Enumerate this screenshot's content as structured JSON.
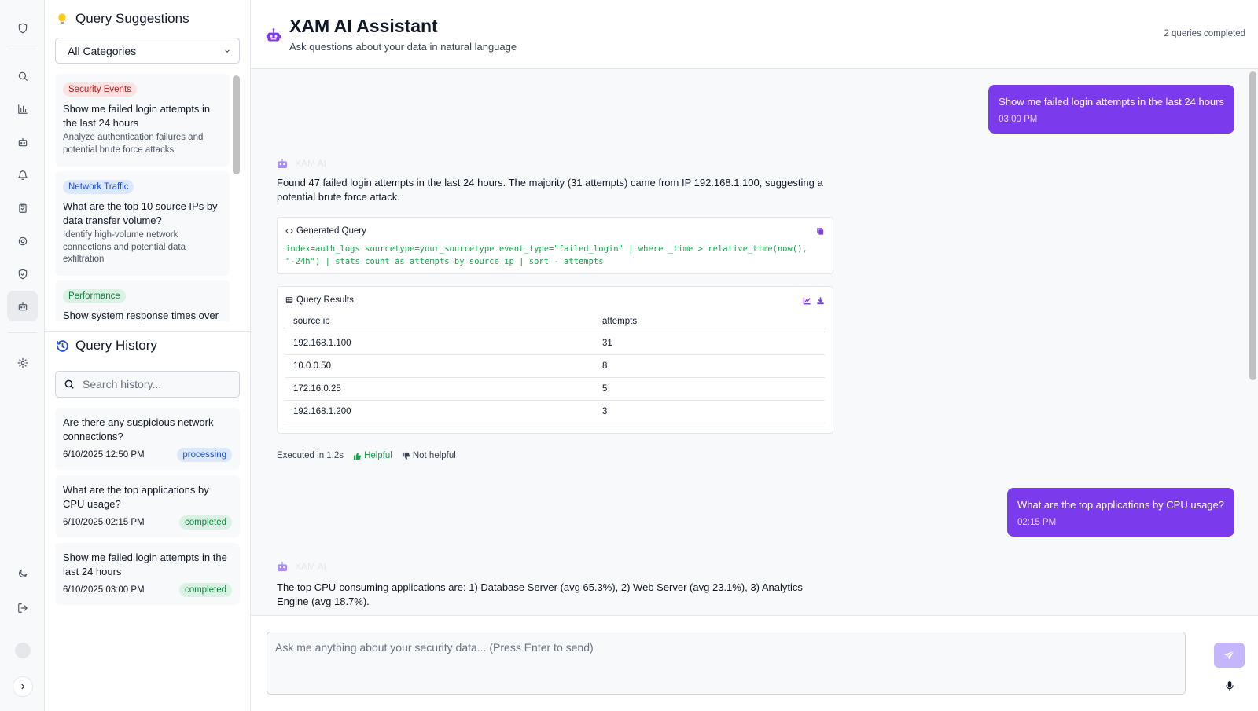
{
  "rail": {
    "icons": [
      "shield-icon",
      "search-icon",
      "bar-chart-icon",
      "robot-icon",
      "bell-icon",
      "clipboard-icon",
      "gear-icon",
      "shield-check-icon",
      "robot-icon",
      "settings-icon",
      "moon-icon",
      "logout-icon",
      "chevron-right-icon"
    ]
  },
  "suggestions": {
    "title": "Query Suggestions",
    "filter_value": "All Categories",
    "items": [
      {
        "category": "Security Events",
        "query": "Show me failed login attempts in the last 24 hours",
        "desc": "Analyze authentication failures and potential brute force attacks"
      },
      {
        "category": "Network Traffic",
        "query": "What are the top 10 source IPs by data transfer volume?",
        "desc": "Identify high-volume network connections and potential data exfiltration"
      },
      {
        "category": "Performance",
        "query": "Show system response times over"
      }
    ]
  },
  "history": {
    "title": "Query History",
    "search_placeholder": "Search history...",
    "items": [
      {
        "query": "Are there any suspicious network connections?",
        "time": "6/10/2025 12:50 PM",
        "status": "processing"
      },
      {
        "query": "What are the top applications by CPU usage?",
        "time": "6/10/2025 02:15 PM",
        "status": "completed"
      },
      {
        "query": "Show me failed login attempts in the last 24 hours",
        "time": "6/10/2025 03:00 PM",
        "status": "completed"
      }
    ]
  },
  "header": {
    "title": "XAM AI Assistant",
    "subtitle": "Ask questions about your data in natural language",
    "count": "2 queries completed"
  },
  "chat": {
    "ai_name": "XAM AI",
    "messages": [
      {
        "role": "user",
        "text": "Show me failed login attempts in the last 24 hours",
        "time": "03:00 PM"
      },
      {
        "role": "ai",
        "text": "Found 47 failed login attempts in the last 24 hours. The majority (31 attempts) came from IP 192.168.1.100, suggesting a potential brute force attack."
      },
      {
        "role": "user",
        "text": "What are the top applications by CPU usage?",
        "time": "02:15 PM"
      },
      {
        "role": "ai",
        "text": "The top CPU-consuming applications are: 1) Database Server (avg 65.3%), 2) Web Server (avg 23.1%), 3) Analytics Engine (avg 18.7%)."
      }
    ],
    "generated_query": {
      "label": "Generated Query",
      "code": "index=auth_logs sourcetype=your_sourcetype event_type=\"failed_login\" | where _time > relative_time(now(), \"-24h\") | stats count as attempts by source_ip | sort - attempts"
    },
    "results": {
      "label": "Query Results",
      "columns": [
        "source ip",
        "attempts"
      ],
      "rows": [
        [
          "192.168.1.100",
          "31"
        ],
        [
          "10.0.0.50",
          "8"
        ],
        [
          "172.16.0.25",
          "5"
        ],
        [
          "192.168.1.200",
          "3"
        ]
      ]
    },
    "exec": {
      "time": "Executed in 1.2s",
      "helpful": "Helpful",
      "not_helpful": "Not helpful"
    }
  },
  "composer": {
    "placeholder": "Ask me anything about your security data... (Press Enter to send)"
  },
  "colors": {
    "accent": "#7c3aed",
    "accent_light": "#c4b5fd",
    "success": "#16a34a",
    "danger": "#b91c1c",
    "info": "#1d4ed8"
  }
}
